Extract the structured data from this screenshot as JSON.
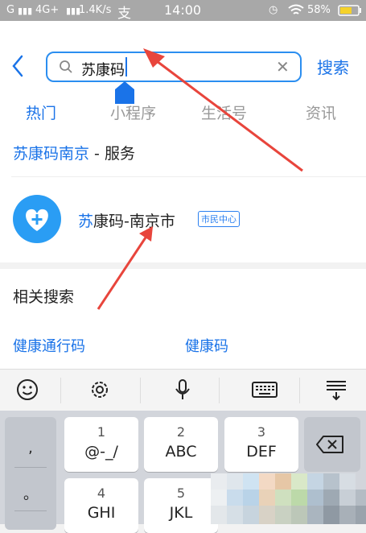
{
  "status_bar": {
    "carrier": "G",
    "network": "4G+",
    "speed": "1.4K/s",
    "time": "14:00",
    "battery": "58%"
  },
  "search": {
    "query": "苏康码",
    "button_label": "搜索"
  },
  "tabs": [
    {
      "label": "热门",
      "active": true
    },
    {
      "label": "小程序",
      "active": false
    },
    {
      "label": "生活号",
      "active": false
    },
    {
      "label": "资讯",
      "active": false
    }
  ],
  "service": {
    "title_highlight": "苏康码南京",
    "title_suffix": " - 服务",
    "app_name_highlight": "苏",
    "app_name_rest": "康码-南京市",
    "badge": "市民中心"
  },
  "related": {
    "title": "相关搜索",
    "items": [
      "健康通行码",
      "健康码"
    ]
  },
  "keyboard": {
    "punctuation": [
      ",",
      "。"
    ],
    "keys": [
      {
        "digit": "1",
        "letters": "@-_/"
      },
      {
        "digit": "2",
        "letters": "ABC"
      },
      {
        "digit": "3",
        "letters": "DEF"
      },
      {
        "digit": "4",
        "letters": "GHI"
      },
      {
        "digit": "5",
        "letters": "JKL"
      }
    ]
  },
  "colors": {
    "accent": "#1a73e8",
    "avatar": "#2a9df4",
    "arrow": "#e8453c"
  }
}
